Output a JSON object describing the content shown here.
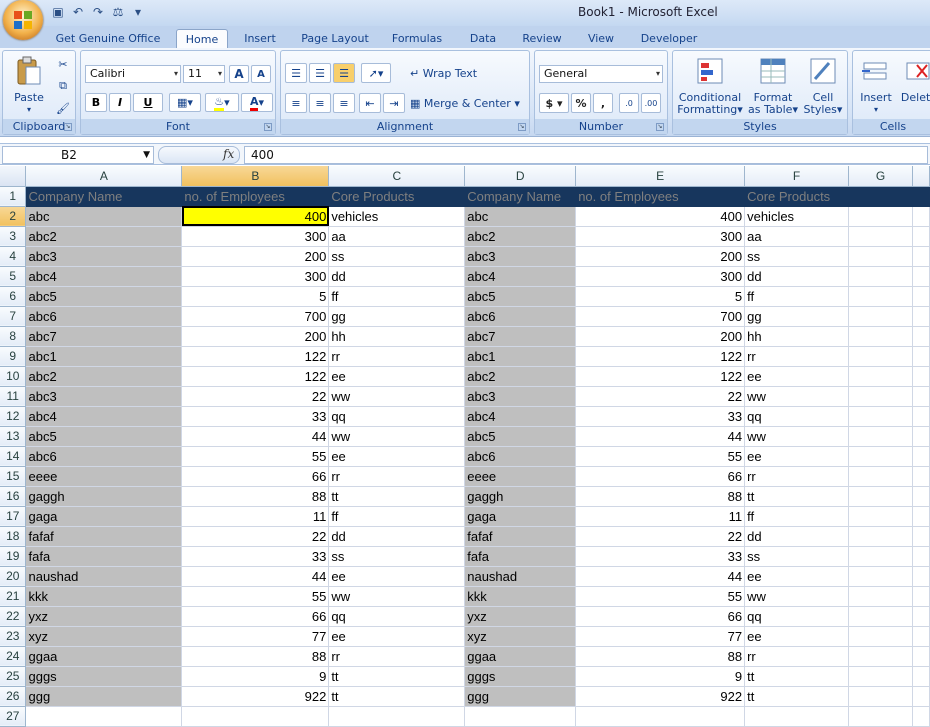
{
  "window": {
    "title": "Book1 - Microsoft Excel"
  },
  "quick_access": [
    "save-icon",
    "undo-icon",
    "redo-icon",
    "print-preview-icon",
    "customize-icon"
  ],
  "tabs": [
    "Get Genuine Office",
    "Home",
    "Insert",
    "Page Layout",
    "Formulas",
    "Data",
    "Review",
    "View",
    "Developer"
  ],
  "active_tab": "Home",
  "ribbon": {
    "clipboard": {
      "label": "Clipboard",
      "paste": "Paste"
    },
    "font": {
      "label": "Font",
      "name": "Calibri",
      "size": "11",
      "bold": "B",
      "italic": "I",
      "underline": "U",
      "grow": "A",
      "shrink": "A",
      "color": "A"
    },
    "alignment": {
      "label": "Alignment",
      "wrap": "Wrap Text",
      "merge": "Merge & Center"
    },
    "number": {
      "label": "Number",
      "format": "General",
      "currency": "$",
      "percent": "%",
      "comma": ","
    },
    "styles": {
      "label": "Styles",
      "conditional": [
        "Conditional",
        "Formatting"
      ],
      "table": [
        "Format",
        "as Table"
      ],
      "cell": [
        "Cell",
        "Styles"
      ]
    },
    "cells": {
      "label": "Cells",
      "insert": "Insert",
      "delete": "Delete"
    }
  },
  "formula_bar": {
    "name_box": "B2",
    "fx": "fx",
    "value": "400"
  },
  "columns": [
    "A",
    "B",
    "C",
    "D",
    "E",
    "F",
    "G"
  ],
  "header_row": [
    "Company Name",
    "no. of Employees",
    "Core Products",
    "Company Name",
    "no. of Employees",
    "Core Products",
    ""
  ],
  "rows": [
    [
      "abc",
      "400",
      "vehicles"
    ],
    [
      "abc2",
      "300",
      "aa"
    ],
    [
      "abc3",
      "200",
      "ss"
    ],
    [
      "abc4",
      "300",
      "dd"
    ],
    [
      "abc5",
      "5",
      "ff"
    ],
    [
      "abc6",
      "700",
      "gg"
    ],
    [
      "abc7",
      "200",
      "hh"
    ],
    [
      "abc1",
      "122",
      "rr"
    ],
    [
      "abc2",
      "122",
      "ee"
    ],
    [
      "abc3",
      "22",
      "ww"
    ],
    [
      "abc4",
      "33",
      "qq"
    ],
    [
      "abc5",
      "44",
      "ww"
    ],
    [
      "abc6",
      "55",
      "ee"
    ],
    [
      "eeee",
      "66",
      "rr"
    ],
    [
      "gaggh",
      "88",
      "tt"
    ],
    [
      "gaga",
      "11",
      "ff"
    ],
    [
      "fafaf",
      "22",
      "dd"
    ],
    [
      "fafa",
      "33",
      "ss"
    ],
    [
      "naushad",
      "44",
      "ee"
    ],
    [
      "kkk",
      "55",
      "ww"
    ],
    [
      "yxz",
      "66",
      "qq"
    ],
    [
      "xyz",
      "77",
      "ee"
    ],
    [
      "ggaa",
      "88",
      "rr"
    ],
    [
      "gggs",
      "9",
      "tt"
    ],
    [
      "ggg",
      "922",
      "tt"
    ]
  ],
  "last_row_number": "27",
  "colors": {
    "header_fill": "#17365d",
    "gray_fill": "#bfbfbf",
    "selected_fill": "#ffff00"
  }
}
